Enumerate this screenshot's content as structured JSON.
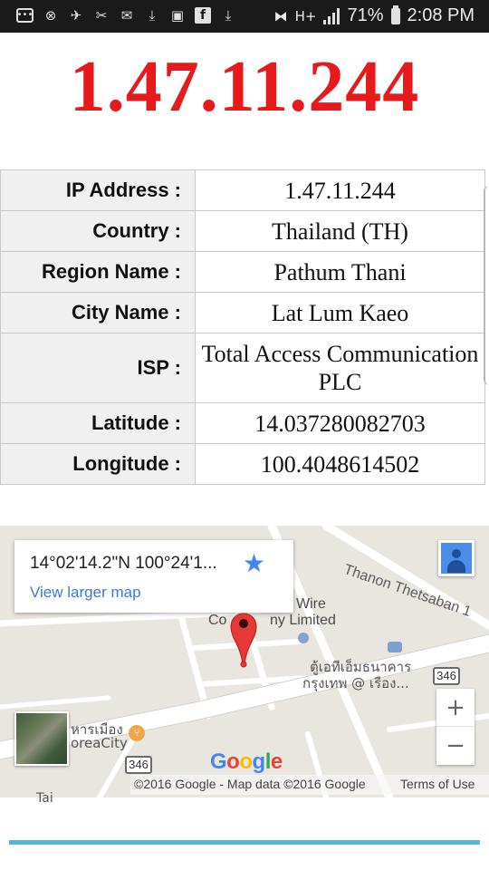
{
  "status_bar": {
    "left_icons": [
      "chat-icon",
      "xbox-icon",
      "bird-icon",
      "mute-icon",
      "mail-icon",
      "download-icon",
      "image-icon",
      "facebook-icon",
      "download-icon"
    ],
    "battery": "71%",
    "time": "2:08 PM",
    "network": "H+"
  },
  "page": {
    "heading": "1.47.11.244"
  },
  "info": {
    "rows": [
      {
        "label": "IP Address :",
        "value": "1.47.11.244"
      },
      {
        "label": "Country :",
        "value": "Thailand (TH)"
      },
      {
        "label": "Region Name :",
        "value": "Pathum Thani"
      },
      {
        "label": "City Name :",
        "value": "Lat Lum Kaeo"
      },
      {
        "label": "ISP :",
        "value": "Total Access Communication PLC"
      },
      {
        "label": "Latitude :",
        "value": "14.037280082703"
      },
      {
        "label": "Longitude :",
        "value": "100.4048614502"
      }
    ]
  },
  "map": {
    "coordinates": "14°02'14.2\"N 100°24'1...",
    "view_larger": "View larger map",
    "road_label": "Thanon Thetsaban 1",
    "company_line1": "Wire",
    "company_line2_a": "Co",
    "company_line2_b": "ny Limited",
    "atm_line1": "ตู้เอทีเอ็มธนาคาร",
    "atm_line2": "กรุงเทพ @ เรือง...",
    "korea_line1": "หารเมือง",
    "korea_line2": "oreaCity",
    "route_number": "346",
    "zoom_in": "+",
    "zoom_out": "−",
    "google": "Google",
    "attribution": "©2016 Google - Map data ©2016 Google",
    "terms": "Terms of Use",
    "bottom_fragment": "Tai"
  },
  "colors": {
    "heading": "#e8191a",
    "label_bg": "#f0f0f0",
    "pin": "#e53935",
    "accent_line": "#4fb6de",
    "link": "#3c78d8"
  }
}
